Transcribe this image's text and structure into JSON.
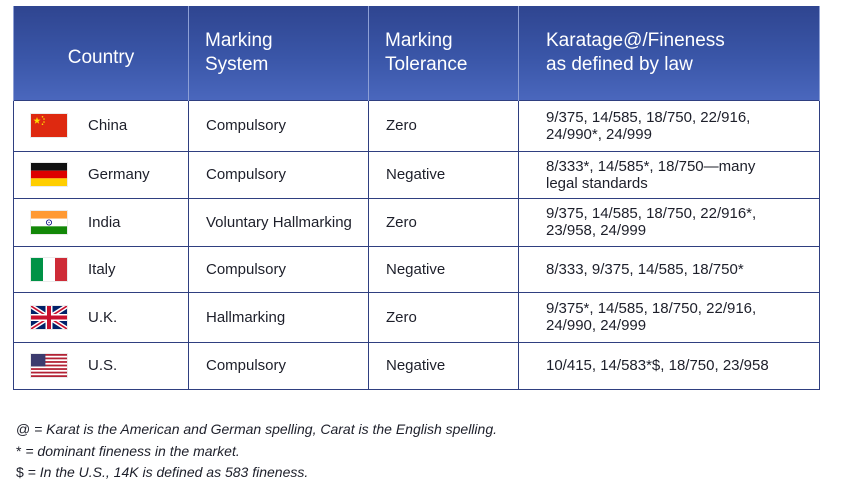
{
  "table": {
    "headers": {
      "country": "Country",
      "marking_system": [
        "Marking",
        "System"
      ],
      "marking_tolerance": [
        "Marking",
        "Tolerance"
      ],
      "fineness": [
        "Karatage@/Fineness",
        "as defined by law"
      ]
    },
    "rows": [
      {
        "country": "China",
        "flag": "china-flag",
        "system": "Compulsory",
        "tolerance": "Zero",
        "fineness": [
          "9/375, 14/585, 18/750, 22/916,",
          "24/990*, 24/999"
        ]
      },
      {
        "country": "Germany",
        "flag": "germany-flag",
        "system": "Compulsory",
        "tolerance": "Negative",
        "fineness": [
          "8/333*, 14/585*, 18/750—many",
          "legal standards"
        ]
      },
      {
        "country": "India",
        "flag": "india-flag",
        "system": "Voluntary Hallmarking",
        "tolerance": "Zero",
        "fineness": [
          "9/375, 14/585, 18/750, 22/916*,",
          "23/958, 24/999"
        ]
      },
      {
        "country": "Italy",
        "flag": "italy-flag",
        "system": "Compulsory",
        "tolerance": "Negative",
        "fineness": [
          "8/333, 9/375, 14/585, 18/750*"
        ]
      },
      {
        "country": "U.K.",
        "flag": "uk-flag",
        "system": "Hallmarking",
        "tolerance": "Zero",
        "fineness": [
          "9/375*, 14/585, 18/750, 22/916,",
          "24/990, 24/999"
        ]
      },
      {
        "country": "U.S.",
        "flag": "us-flag",
        "system": "Compulsory",
        "tolerance": "Negative",
        "fineness": [
          "10/415, 14/583*$, 18/750, 23/958"
        ]
      }
    ]
  },
  "notes": [
    {
      "symbol": "@",
      "text": " = Karat is the American and German spelling, Carat is the English spelling."
    },
    {
      "symbol": "*",
      "text": " = dominant fineness in the market."
    },
    {
      "symbol": "$",
      "text": " = In the U.S., 14K is defined as 583 fineness."
    }
  ],
  "colors": {
    "header_blue": "#3a56a8",
    "border_navy": "#2f3f80"
  }
}
